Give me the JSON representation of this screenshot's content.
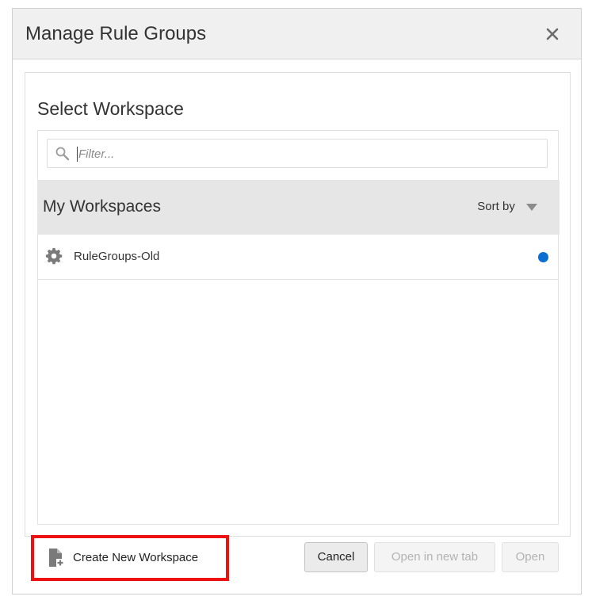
{
  "dialog": {
    "title": "Manage Rule Groups",
    "close_icon": "close-icon"
  },
  "section": {
    "title": "Select Workspace"
  },
  "filter": {
    "placeholder": "Filter...",
    "value": "",
    "icon": "search-icon"
  },
  "workspaces": {
    "header": "My Workspaces",
    "sort_label": "Sort by",
    "sort_icon": "caret-down-icon",
    "items": [
      {
        "label": "RuleGroups-Old",
        "icon": "gear-icon",
        "status": "active",
        "status_color": "#0a6fd1"
      }
    ]
  },
  "footer": {
    "create_label": "Create New Workspace",
    "create_icon": "new-document-icon",
    "highlight_color": "#ee1111",
    "cancel_label": "Cancel",
    "open_new_tab_label": "Open in new tab",
    "open_label": "Open"
  }
}
